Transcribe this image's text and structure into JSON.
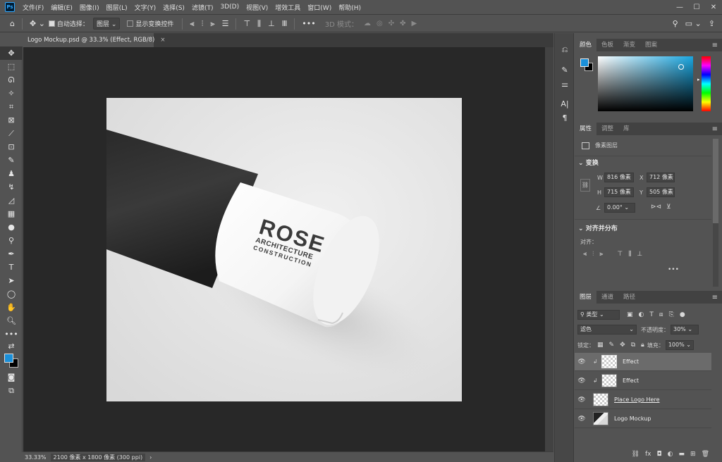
{
  "app": {
    "logo": "Ps"
  },
  "menu": [
    "文件(F)",
    "编辑(E)",
    "图像(I)",
    "图层(L)",
    "文字(Y)",
    "选择(S)",
    "滤镜(T)",
    "3D(D)",
    "视图(V)",
    "增效工具",
    "窗口(W)",
    "帮助(H)"
  ],
  "window_controls": {
    "minimize": "—",
    "restore": "☐",
    "close": "✕"
  },
  "options_bar": {
    "auto_select_label": "自动选择：",
    "auto_select_value": "图层",
    "show_transform_label": "显示变换控件",
    "more": "•••",
    "mode_3d": "3D 模式："
  },
  "document": {
    "tab_title": "Logo Mockup.psd @ 33.3% (Effect, RGB/8)",
    "close": "×",
    "logo_word": "ROSE",
    "logo_line1": "ARCHITECTURE",
    "logo_line2": "CONSTRUCTION"
  },
  "status": {
    "zoom": "33.33%",
    "info": "2100 像素 x 1800 像素 (300 ppi)",
    "arrow": "›"
  },
  "color_panel": {
    "tabs": [
      "颜色",
      "色板",
      "渐变",
      "图案"
    ],
    "foreground": "#1a8fd8",
    "background": "#000000"
  },
  "properties_panel": {
    "tabs": [
      "属性",
      "调整",
      "库"
    ],
    "layer_type": "像素图层",
    "transform_title": "变换",
    "w_label": "W",
    "w_value": "816 像素",
    "h_label": "H",
    "h_value": "715 像素",
    "x_label": "X",
    "x_value": "712 像素",
    "y_label": "Y",
    "y_value": "505 像素",
    "angle_value": "0.00°",
    "align_title": "对齐并分布",
    "align_label": "对齐：",
    "more": "•••"
  },
  "layers_panel": {
    "tabs": [
      "图层",
      "通道",
      "路径"
    ],
    "filter_label": "类型",
    "blend_mode": "滤色",
    "opacity_label": "不透明度：",
    "opacity_value": "30%",
    "lock_label": "锁定：",
    "fill_label": "填充：",
    "fill_value": "100%",
    "layers": [
      {
        "name": "Effect",
        "selected": true,
        "clipped": true
      },
      {
        "name": "Effect",
        "selected": false,
        "clipped": true
      },
      {
        "name": "Place Logo Here",
        "selected": false,
        "clipped": false
      },
      {
        "name": "Logo Mockup",
        "selected": false,
        "clipped": false
      }
    ]
  }
}
